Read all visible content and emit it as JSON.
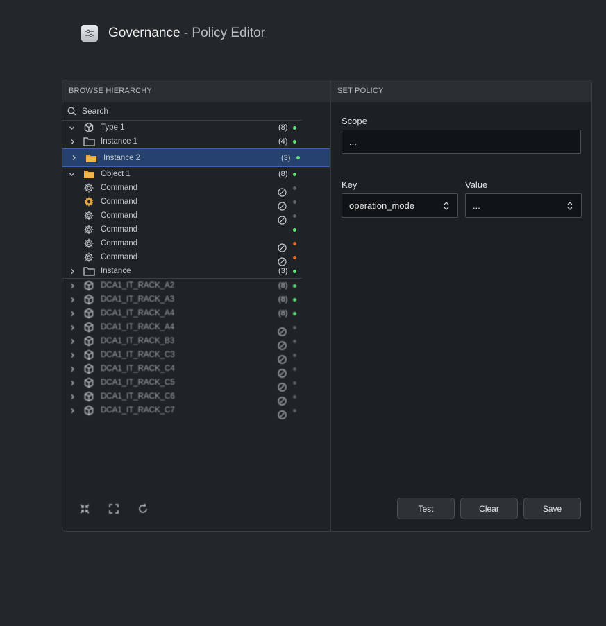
{
  "header": {
    "icon": "sliders-icon",
    "title_main": "Governance - ",
    "title_sub": "Policy Editor"
  },
  "browse": {
    "heading": "BROWSE HIERARCHY",
    "search_placeholder": "Search",
    "rows": [
      {
        "label": "Type 1",
        "icon": "cube-icon",
        "chevron": "down",
        "count": "(8)",
        "status": "green"
      },
      {
        "label": "Instance 1",
        "icon": "folder-icon",
        "chevron": "right",
        "count": "(4)",
        "status": "green"
      },
      {
        "label": "Instance 2",
        "icon": "folder-filled-icon",
        "chevron": "right",
        "count": "(3)",
        "status": "green",
        "selected": true
      },
      {
        "label": "Object 1",
        "icon": "folder-filled-icon",
        "chevron": "down",
        "count": "(8)",
        "status": "green"
      },
      {
        "label": "Command",
        "icon": "gear-icon",
        "status": "gray",
        "disabled": true
      },
      {
        "label": "Command",
        "icon": "gear-filled-icon",
        "status": "gray",
        "disabled": true
      },
      {
        "label": "Command",
        "icon": "gear-icon",
        "status": "gray",
        "disabled": true
      },
      {
        "label": "Command",
        "icon": "gear-icon",
        "status": "green"
      },
      {
        "label": "Command",
        "icon": "gear-icon",
        "status": "orange",
        "disabled": true
      },
      {
        "label": "Command",
        "icon": "gear-icon",
        "status": "orange",
        "disabled": true
      },
      {
        "label": "Instance",
        "icon": "folder-icon",
        "chevron": "right",
        "count": "(3)",
        "status": "green"
      }
    ],
    "racks": [
      {
        "label": "DCA1_IT_RACK_A2",
        "count": "(8)",
        "status": "green"
      },
      {
        "label": "DCA1_IT_RACK_A3",
        "count": "(8)",
        "status": "green"
      },
      {
        "label": "DCA1_IT_RACK_A4",
        "count": "(8)",
        "status": "green"
      },
      {
        "label": "DCA1_IT_RACK_A4",
        "status": "gray",
        "disabled": true
      },
      {
        "label": "DCA1_IT_RACK_B3",
        "status": "gray",
        "disabled": true
      },
      {
        "label": "DCA1_IT_RACK_C3",
        "status": "gray",
        "disabled": true
      },
      {
        "label": "DCA1_IT_RACK_C4",
        "status": "gray",
        "disabled": true
      },
      {
        "label": "DCA1_IT_RACK_C5",
        "status": "gray",
        "disabled": true
      },
      {
        "label": "DCA1_IT_RACK_C6",
        "status": "gray",
        "disabled": true
      },
      {
        "label": "DCA1_IT_RACK_C7",
        "status": "gray",
        "disabled": true
      }
    ],
    "tools": [
      "collapse-icon",
      "expand-icon",
      "refresh-icon"
    ]
  },
  "policy": {
    "heading": "SET POLICY",
    "scope_label": "Scope",
    "scope_value": "...",
    "key_label": "Key",
    "key_value": "operation_mode",
    "value_label": "Value",
    "value_value": "...",
    "buttons": {
      "test": "Test",
      "clear": "Clear",
      "save": "Save"
    }
  },
  "colors": {
    "background": "#23272a",
    "selected_row": "#25426f",
    "status_green": "#64e07a",
    "status_orange": "#e66a2c",
    "status_gray": "#5c6266"
  }
}
